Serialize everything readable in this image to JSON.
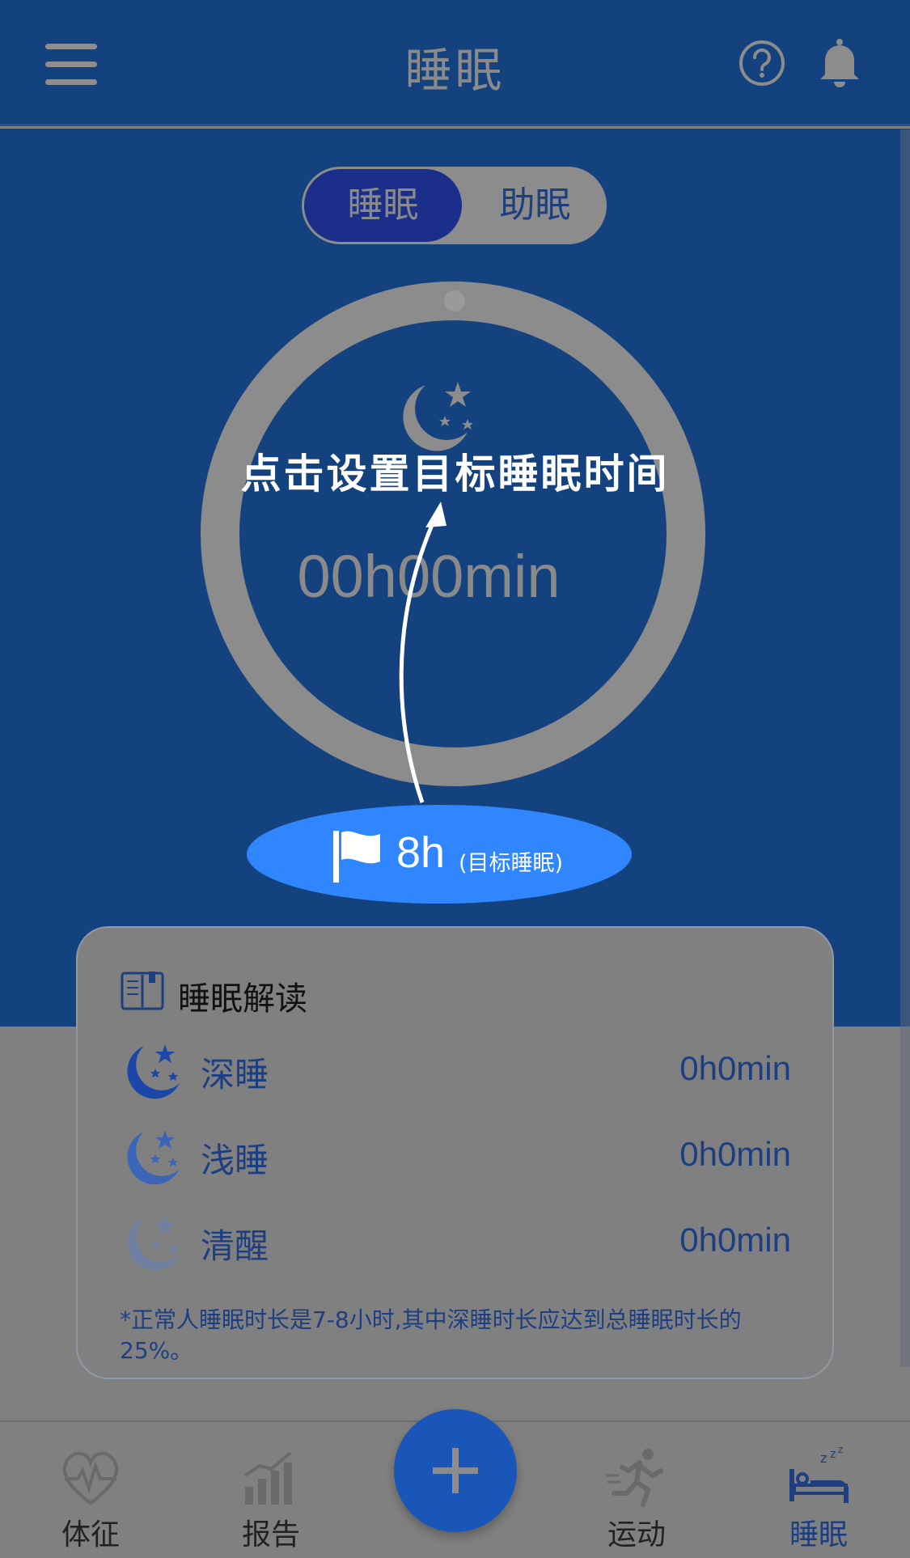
{
  "header": {
    "title": "睡眠",
    "icons": [
      "menu-icon",
      "help-icon",
      "bell-icon"
    ]
  },
  "segment": {
    "active": "睡眠",
    "inactive": "助眠"
  },
  "dial": {
    "time": "00h00min"
  },
  "overlay": {
    "tip": "点击设置目标睡眠时间"
  },
  "goal": {
    "value": "8h",
    "label": "(目标睡眠)"
  },
  "analysis": {
    "title": "睡眠解读",
    "rows": [
      {
        "name": "深睡",
        "value": "0h0min"
      },
      {
        "name": "浅睡",
        "value": "0h0min"
      },
      {
        "name": "清醒",
        "value": "0h0min"
      }
    ],
    "note": "*正常人睡眠时长是7-8小时,其中深睡时长应达到总睡眠时长的25%。"
  },
  "tabs": [
    {
      "label": "体征"
    },
    {
      "label": "报告"
    },
    {
      "label": "运动"
    },
    {
      "label": "睡眠"
    }
  ],
  "colors": {
    "primary": "#14427f",
    "accent": "#2f86ff",
    "text_blue": "#1d3f82",
    "overlay_gray": "#808080"
  }
}
